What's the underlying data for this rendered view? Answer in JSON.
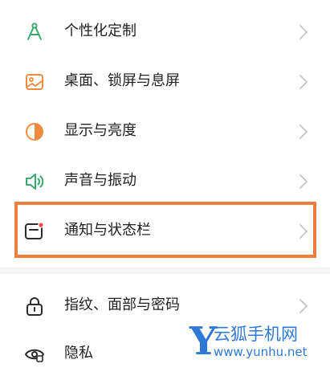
{
  "settings": {
    "items": [
      {
        "label": "个性化定制",
        "icon": "compass-icon"
      },
      {
        "label": "桌面、锁屏与息屏",
        "icon": "wallpaper-icon"
      },
      {
        "label": "显示与亮度",
        "icon": "brightness-icon"
      },
      {
        "label": "声音与振动",
        "icon": "speaker-icon"
      },
      {
        "label": "通知与状态栏",
        "icon": "notification-icon"
      },
      {
        "label": "指纹、面部与密码",
        "icon": "lock-icon"
      },
      {
        "label": "隐私",
        "icon": "privacy-eye-icon"
      }
    ],
    "highlighted_index": 4
  },
  "watermark": {
    "logo": "Y",
    "name": "云狐手机网",
    "url": "www.yunhu.net"
  },
  "colors": {
    "highlight_border": "#ee7d3e",
    "icon_green": "#3aa86b",
    "icon_orange": "#f08a3c",
    "icon_dark": "#2b2b2b",
    "watermark_blue": "#2f79d6"
  }
}
